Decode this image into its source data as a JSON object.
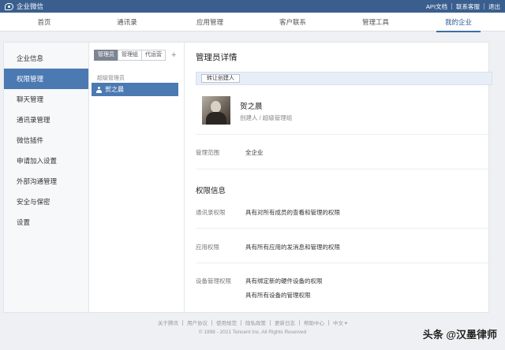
{
  "app": {
    "title": "企业微信"
  },
  "top_links": [
    "API文档",
    "联系客服",
    "退出"
  ],
  "nav": [
    "首页",
    "通讯录",
    "应用管理",
    "客户联系",
    "管理工具",
    "我的企业"
  ],
  "nav_active": "我的企业",
  "sidebar": [
    "企业信息",
    "权限管理",
    "聊天管理",
    "通讯录管理",
    "微信插件",
    "申请加入设置",
    "外部沟通管理",
    "安全与保密",
    "设置"
  ],
  "sidebar_active": "权限管理",
  "admin_tabs": [
    "管理员",
    "管理组",
    "代运营"
  ],
  "admin_tab_active": "管理员",
  "group_label": "超级管理员",
  "selected_admin": "贺之晨",
  "detail": {
    "title": "管理员详情",
    "transfer_button": "转让创建人",
    "user_name": "贺之晨",
    "user_role": "创建人 / 超级管理组",
    "scope_label": "管理范围",
    "scope_value": "全企业",
    "permissions_title": "权限信息",
    "permissions": [
      {
        "label": "通讯录权限",
        "values": [
          "具有对所有成员的查看和管理的权限"
        ]
      },
      {
        "label": "应用权限",
        "values": [
          "具有所有应用的发消息和管理的权限"
        ]
      },
      {
        "label": "设备管理权限",
        "values": [
          "具有绑定新的硬件设备的权限",
          "具有所有设备的管理权限"
        ]
      }
    ]
  },
  "footer": {
    "links": [
      "关于腾讯",
      "用户协议",
      "使用规范",
      "隐私政策",
      "更新日志",
      "帮助中心",
      "中文 ▾"
    ],
    "copyright": "© 1998 - 2021 Tencent Inc. All Rights Reserved"
  },
  "watermark": "头条 @汉墨律师",
  "colors": {
    "topbar": "#3a5f8e",
    "accent": "#4b79b2",
    "page_bg": "#eef0f3"
  }
}
